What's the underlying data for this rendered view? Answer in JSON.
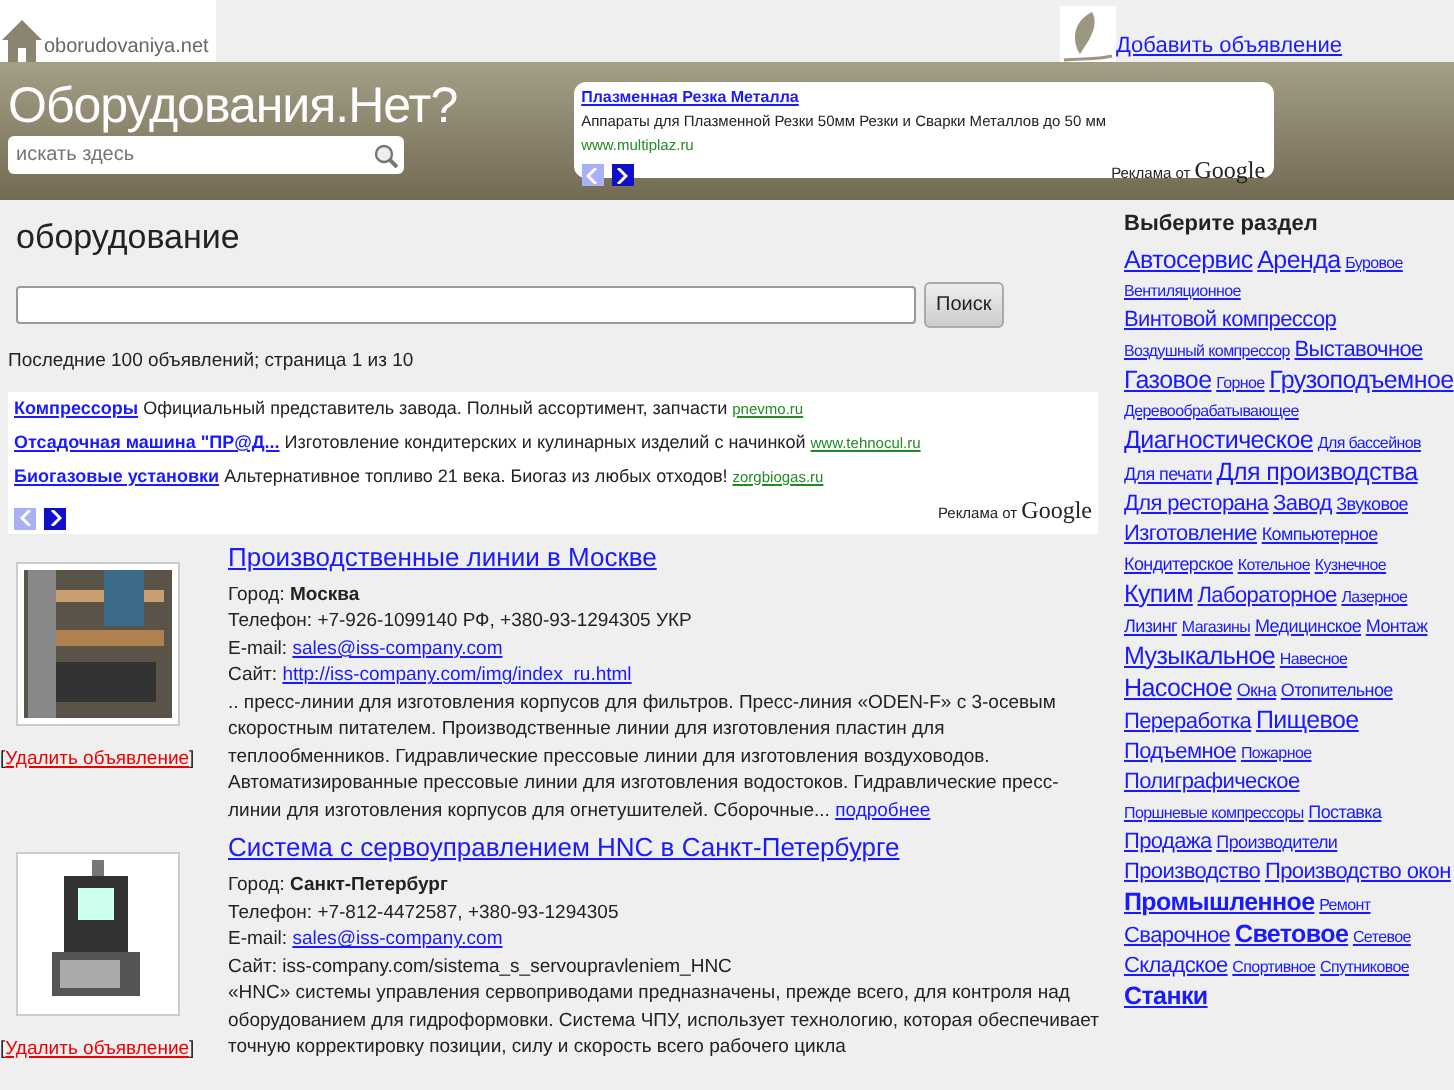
{
  "header": {
    "logo_text": "oborudovaniya.net",
    "add_link": "Добавить объявление",
    "site_title": "Оборудования.Нет?",
    "search": {
      "placeholder": "искать здесь"
    },
    "ad": {
      "title": "Плазменная Резка Металла",
      "text": "Аппараты для Плазменной Резки 50мм Резки и Сварки Металлов до 50 мм",
      "url": "www.multiplaz.ru",
      "credit": "Реклама от",
      "brand": "Google"
    }
  },
  "main": {
    "heading": "оборудование",
    "search_button": "Поиск",
    "summary": "Последние 100 объявлений; страница 1 из 10",
    "ads": [
      {
        "title": "Компрессоры",
        "text": "Официальный представитель завода. Полный ассортимент, запчасти",
        "url": "pnevmo.ru"
      },
      {
        "title": "Отсадочная машина \"ПР@Д...",
        "text": "Изготовление кондитерских и кулинарных изделий с начинкой",
        "url": "www.tehnocul.ru"
      },
      {
        "title": "Биогазовые установки",
        "text": "Альтернативное топливо 21 века. Биогаз из любых отходов!",
        "url": "zorgbiogas.ru"
      }
    ],
    "ads_credit": "Реклама от",
    "ads_brand": "Google",
    "listings": [
      {
        "title": "Производственные линии в Москве",
        "city": "Город: **Москва**",
        "phone": "Телефон: +7-926-1099140 РФ, +380-93-1294305 УКР",
        "email_label": "E-mail:",
        "email": "sales@iss-company.com",
        "site_label": "Сайт:",
        "site": "http://iss-company.com/img/index_ru.html",
        "site_is_link": true,
        "description": ".. пресс-линии для изготовления корпусов для фильтров. Пресс-линия «ODEN-F» с 3-осевым скоростным питателем. Производственные линии для изготовления пластин для теплообменников. Гидравлические прессовые линии для изготовления воздуховодов. Автоматизированные прессовые линии для изготовления водостоков. Гидравлические пресс-линии для изготовления корпусов для огнетушителей. Сборочные...",
        "more": "подробнее",
        "delete_open": "[",
        "delete": "Удалить объявление",
        "delete_close": "]"
      },
      {
        "title": "Система с сервоуправлением HNC в Санкт-Петербурге",
        "city": "Город: **Санкт-Петербург**",
        "phone": "Телефон: +7-812-4472587, +380-93-1294305",
        "email_label": "E-mail:",
        "email": "sales@iss-company.com",
        "site_label": "Сайт:",
        "site": "iss-company.com/sistema_s_servoupravleniem_HNC",
        "site_is_link": false,
        "description": "«HNC» системы управления сервоприводами предназначены, прежде всего, для контроля над оборудованием для гидроформовки. Система ЧПУ, использует технологию, которая обеспечивает точную корректировку позиции, силу и скорость всего рабочего цикла",
        "delete_open": "[",
        "delete": "Удалить объявление",
        "delete_close": "]"
      }
    ]
  },
  "sidebar": {
    "title": "Выберите раздел",
    "tags": [
      {
        "label": "Автосервис",
        "kind": "l"
      },
      {
        "label": "Аренда",
        "kind": "l"
      },
      {
        "label": "Буровое",
        "kind": "xs"
      },
      {
        "label": "Вентиляционное",
        "kind": "xs"
      },
      {
        "label": "Винтовой компрессор",
        "kind": "m"
      },
      {
        "label": "Воздушный компрессор",
        "kind": "xs"
      },
      {
        "label": "Выставочное",
        "kind": "m"
      },
      {
        "label": "Газовое",
        "kind": "l"
      },
      {
        "label": "Горное",
        "kind": "xs"
      },
      {
        "label": "Грузоподъемное",
        "kind": "l"
      },
      {
        "label": "Деревообрабатывающее",
        "kind": "xs"
      },
      {
        "label": "Диагностическое",
        "kind": "l"
      },
      {
        "label": "Для бассейнов",
        "kind": "xs"
      },
      {
        "label": "Для печати",
        "kind": "s"
      },
      {
        "label": "Для производства",
        "kind": "l"
      },
      {
        "label": "Для ресторана",
        "kind": "m"
      },
      {
        "label": "Завод",
        "kind": "m"
      },
      {
        "label": "Звуковое",
        "kind": "s"
      },
      {
        "label": "Изготовление",
        "kind": "m"
      },
      {
        "label": "Компьютерное",
        "kind": "s"
      },
      {
        "label": "Кондитерское",
        "kind": "s"
      },
      {
        "label": "Котельное",
        "kind": "xs"
      },
      {
        "label": "Кузнечное",
        "kind": "xs"
      },
      {
        "label": "Купим",
        "kind": "l"
      },
      {
        "label": "Лабораторное",
        "kind": "m"
      },
      {
        "label": "Лазерное",
        "kind": "xs"
      },
      {
        "label": "Лизинг",
        "kind": "s"
      },
      {
        "label": "Магазины",
        "kind": "xs"
      },
      {
        "label": "Медицинское",
        "kind": "s"
      },
      {
        "label": "Монтаж",
        "kind": "s"
      },
      {
        "label": "Музыкальное",
        "kind": "l"
      },
      {
        "label": "Навесное",
        "kind": "xs"
      },
      {
        "label": "Насосное",
        "kind": "l"
      },
      {
        "label": "Окна",
        "kind": "s"
      },
      {
        "label": "Отопительное",
        "kind": "s"
      },
      {
        "label": "Переработка",
        "kind": "m"
      },
      {
        "label": "Пищевое",
        "kind": "l"
      },
      {
        "label": "Подъемное",
        "kind": "m"
      },
      {
        "label": "Пожарное",
        "kind": "xs"
      },
      {
        "label": "Полиграфическое",
        "kind": "m"
      },
      {
        "label": "Поршневые компрессоры",
        "kind": "xs"
      },
      {
        "label": "Поставка",
        "kind": "s"
      },
      {
        "label": "Продажа",
        "kind": "m"
      },
      {
        "label": "Производители",
        "kind": "s"
      },
      {
        "label": "Производство",
        "kind": "m"
      },
      {
        "label": "Производство окон",
        "kind": "m"
      },
      {
        "label": "Промышленное",
        "kind": "b"
      },
      {
        "label": "Ремонт",
        "kind": "xs"
      },
      {
        "label": "Сварочное",
        "kind": "m"
      },
      {
        "label": "Световое",
        "kind": "b"
      },
      {
        "label": "Сетевое",
        "kind": "xs"
      },
      {
        "label": "Складское",
        "kind": "m"
      },
      {
        "label": "Спортивное",
        "kind": "xs"
      },
      {
        "label": "Спутниковое",
        "kind": "xs"
      },
      {
        "label": "Станки",
        "kind": "b"
      }
    ]
  }
}
